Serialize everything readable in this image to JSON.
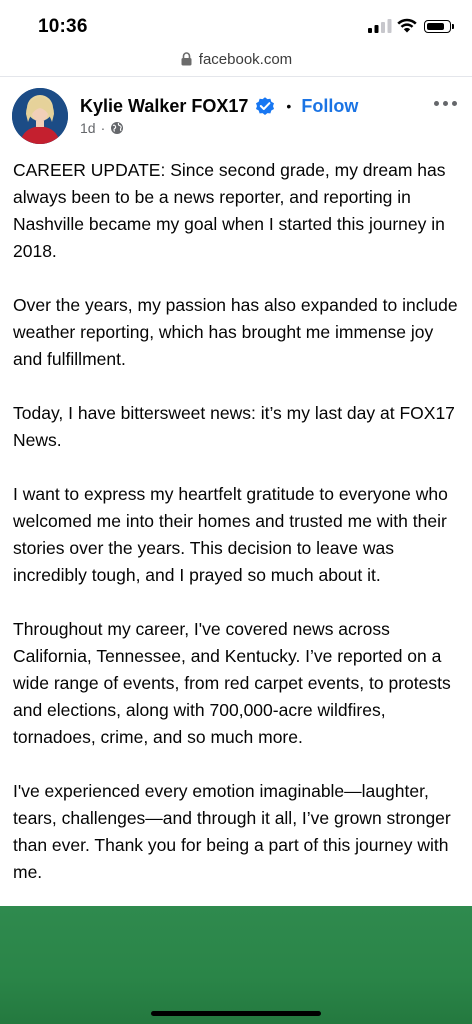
{
  "status_bar": {
    "time": "10:36",
    "battery_level": 0.85
  },
  "browser": {
    "url": "facebook.com"
  },
  "post": {
    "author": "Kylie Walker FOX17",
    "follow_label": "Follow",
    "separator": "•",
    "age": "1d",
    "age_separator": "·",
    "paragraphs": [
      "CAREER UPDATE: Since second grade, my dream has always been to be a news reporter, and reporting in Nashville became my goal when I started this journey in 2018.",
      "Over the years, my passion has also expanded to include weather reporting, which has brought me immense joy and fulfillment.",
      "Today, I have bittersweet news: it’s my last day at FOX17 News.",
      "I want to express my heartfelt gratitude to everyone who welcomed me into their homes and trusted me with their stories over the years. This decision to leave was incredibly tough, and I prayed so much about it.",
      "Throughout my career, I've covered news across California, Tennessee, and Kentucky. I’ve reported on a wide range of events, from red carpet events, to protests and elections, along with 700,000-acre wildfires, tornadoes, crime, and so much more.",
      "I've experienced every emotion imaginable—laughter, tears, challenges—and through it all, I’ve grown stronger than ever. Thank you for being a part of this journey with me."
    ]
  },
  "colors": {
    "link_blue": "#1b74e4",
    "verified_blue": "#1877f2",
    "meta_gray": "#65676b",
    "image_green": "#2f8a4e"
  },
  "icons": {
    "lock": "lock-icon",
    "verified": "verified-badge-icon",
    "globe": "globe-icon",
    "more": "more-options-icon",
    "signal": "cellular-signal-icon",
    "wifi": "wifi-icon",
    "battery": "battery-icon"
  }
}
